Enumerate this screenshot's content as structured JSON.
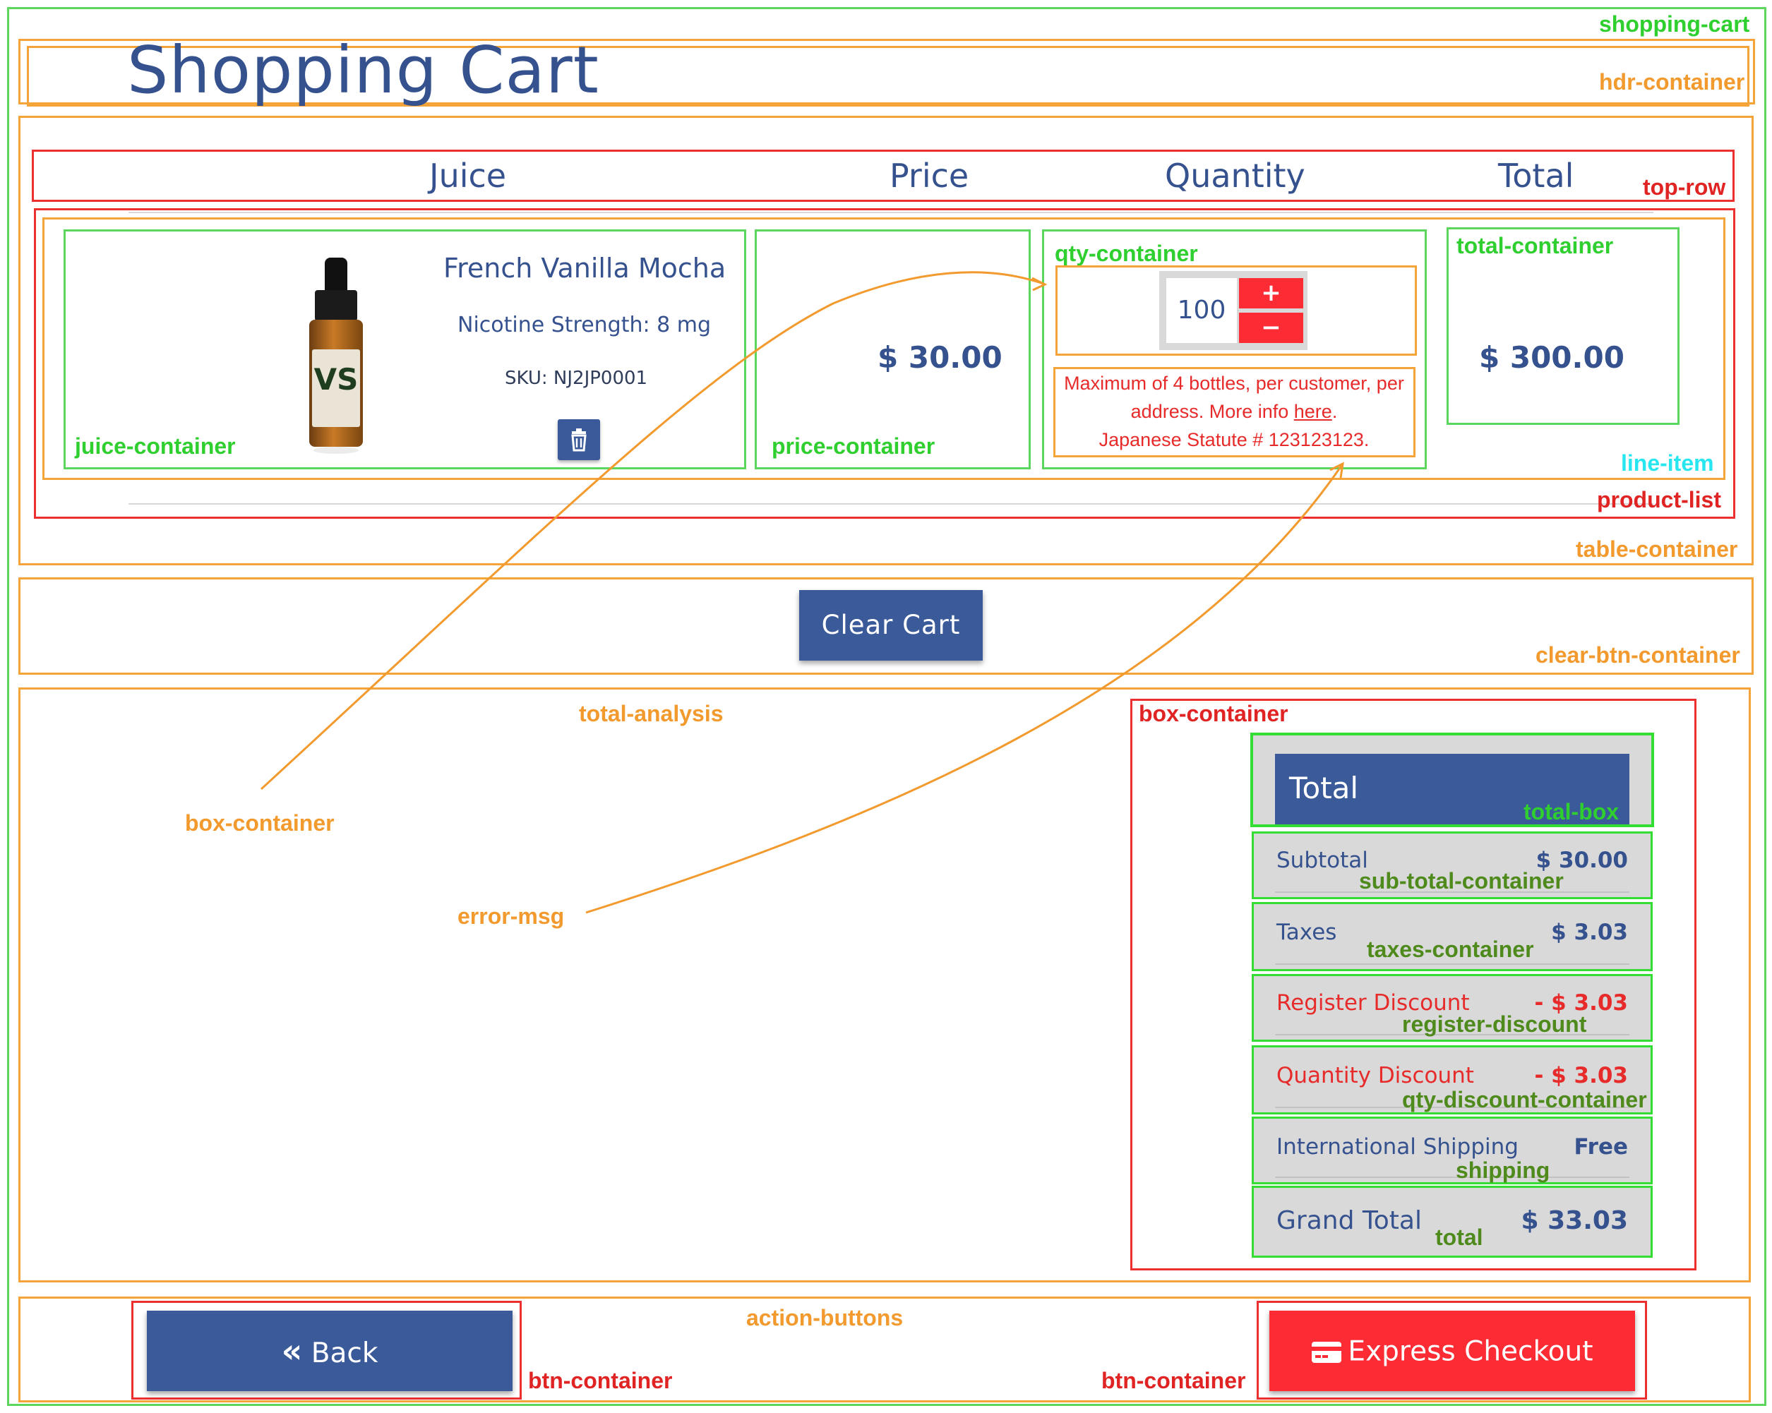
{
  "page": {
    "title": "Shopping Cart"
  },
  "columns": {
    "juice": "Juice",
    "price": "Price",
    "quantity": "Quantity",
    "total": "Total"
  },
  "product": {
    "name": "French Vanilla Mocha",
    "nicotine": "Nicotine Strength: 8 mg",
    "sku": "SKU: NJ2JP0001",
    "price": "$ 30.00",
    "quantity": "100",
    "line_total": "$ 300.00",
    "bottle_label": "VS"
  },
  "qty_buttons": {
    "plus": "+",
    "minus": "−"
  },
  "error_msg": {
    "line1": "Maximum of 4 bottles, per customer, per",
    "line2_prefix": "address. More info ",
    "link": "here",
    "line2_suffix": ".",
    "line3": "Japanese Statute # 123123123."
  },
  "clear_cart_label": "Clear Cart",
  "summary": {
    "header": "Total",
    "rows": [
      {
        "label": "Subtotal",
        "value": "$ 30.00"
      },
      {
        "label": "Taxes",
        "value": "$ 3.03"
      },
      {
        "label": "Register Discount",
        "value": "- $ 3.03"
      },
      {
        "label": "Quantity Discount",
        "value": "- $ 3.03"
      },
      {
        "label": "International Shipping",
        "value": "Free"
      },
      {
        "label": "Grand Total",
        "value": "$ 33.03"
      }
    ]
  },
  "buttons": {
    "back": "Back",
    "back_icon": "«",
    "express_checkout": "Express Checkout"
  },
  "annotations": {
    "shopping_cart": "shopping-cart",
    "hdr_container": "hdr-container",
    "top_row": "top-row",
    "juice_container": "juice-container",
    "price_container": "price-container",
    "qty_container": "qty-container",
    "total_container": "total-container",
    "line_item": "line-item",
    "product_list": "product-list",
    "table_container": "table-container",
    "clear_btn_container": "clear-btn-container",
    "total_analysis": "total-analysis",
    "box_container_red": "box-container",
    "total_box": "total-box",
    "sub_total_container": "sub-total-container",
    "taxes_container": "taxes-container",
    "register_discount": "register-discount",
    "qty_discount_container": "qty-discount-container",
    "shipping": "shipping",
    "total": "total",
    "box_container_callout": "box-container",
    "error_msg_callout": "error-msg",
    "action_buttons": "action-buttons",
    "btn_container_left": "btn-container",
    "btn_container_right": "btn-container"
  },
  "colors": {
    "brand_blue": "#3b5a99",
    "text_blue": "#35528f",
    "danger_red": "#fc2b34",
    "annotation_green": "#33dd33",
    "annotation_orange": "#f5a43a",
    "annotation_red": "#ec2f2f"
  }
}
